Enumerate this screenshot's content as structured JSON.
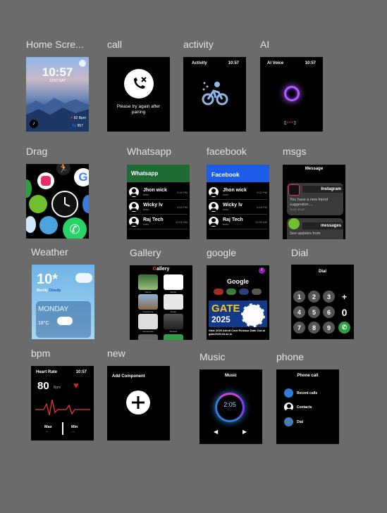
{
  "labels": {
    "home": "Home Scre...",
    "call": "call",
    "activity": "activity",
    "ai": "AI",
    "drag": "Drag",
    "whatsapp": "Whatsapp",
    "facebook": "facebook",
    "msgs": "msgs",
    "weather": "Weather",
    "gallery": "Gallery",
    "google": "google",
    "dial": "Dial",
    "bpm": "bpm",
    "new": "new",
    "music": "Music",
    "phone": "phone"
  },
  "home": {
    "time": "10:57",
    "date": "12/07 SAT",
    "bpm": "82 Bpm",
    "steps": "957"
  },
  "call": {
    "message": "Please try again after pairing"
  },
  "activity": {
    "title": "Activity",
    "time": "10:57"
  },
  "ai": {
    "title": "AI Voice",
    "time": "10:57"
  },
  "whatsapp": {
    "header": "Whatsapp",
    "contacts": [
      {
        "name": "Jhon wick",
        "preview": "hello",
        "time": "2:00 PM"
      },
      {
        "name": "Wicky lv",
        "preview": "hello",
        "time": "9:45 PM"
      },
      {
        "name": "Raj Tech",
        "preview": "hello",
        "time": "10:00 AM"
      }
    ]
  },
  "facebook": {
    "header": "Facebook",
    "contacts": [
      {
        "name": "Jhon wick",
        "preview": "hello",
        "time": "2:00 PM"
      },
      {
        "name": "Wicky lv",
        "preview": "hello",
        "time": "3:45 PM"
      },
      {
        "name": "Raj Tech",
        "preview": "hello",
        "time": "10:00 AM"
      }
    ]
  },
  "msgs": {
    "header": "Message",
    "card1_app": "Instagram",
    "card1_text": "You have a new friend suggestion....",
    "card1_time": "10:57 12-07",
    "card2_app": "messages",
    "card2_text": "See updates from"
  },
  "weather": {
    "temp": "10*",
    "cond1": "Mostly",
    "cond2": "Cloudy",
    "day": "MONDAY",
    "low": "18°C"
  },
  "gallery": {
    "title_first": "G",
    "title_rest": "allery",
    "captions": [
      "Nature",
      "Family",
      "Friends trip",
      "Notes",
      "Documents",
      "Pictures"
    ]
  },
  "google": {
    "title": "Google",
    "avatar": "r",
    "gate_title": "GATE",
    "gate_year": "2025",
    "caption": "Gate 2025 Admit Card Release Date Out at gate2025.iitr.ac.in"
  },
  "dial": {
    "title": "Dial",
    "keys": [
      "1",
      "2",
      "3",
      "+",
      "4",
      "5",
      "6",
      "0",
      "7",
      "8",
      "9"
    ]
  },
  "bpm": {
    "title": "Heart Rate",
    "time": "10:57",
    "value": "80",
    "unit": "Bpm",
    "max_label": "Max",
    "min_label": "Min",
    "max_value": "--",
    "min_value": "--"
  },
  "new": {
    "title": "Add Component"
  },
  "music": {
    "title": "Music",
    "time": "2:05"
  },
  "phone": {
    "title": "Phone call",
    "items": [
      "Recent calls",
      "Contacts",
      "Dial"
    ]
  },
  "colors": {
    "whatsapp": "#1e6b34",
    "facebook": "#1c5ce6",
    "background": "#6b6b6b"
  }
}
